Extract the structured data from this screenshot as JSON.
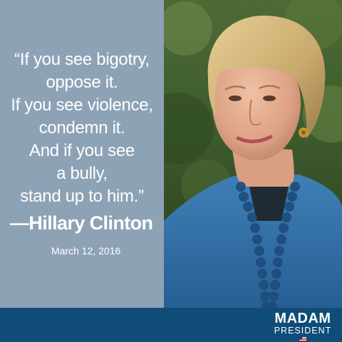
{
  "quote": {
    "lines": [
      "“If you see bigotry,",
      "oppose it.",
      "If you see violence,",
      "condemn it.",
      "And if you see",
      "a bully,",
      "stand up to him.”"
    ],
    "attribution": "—Hillary Clinton",
    "date": "March 12, 2016"
  },
  "brand": {
    "line1": "MADAM",
    "line2": "PRESIDENT"
  },
  "colors": {
    "panel": "#8ea2b6",
    "bar": "#0f4d78",
    "text": "#ffffff"
  },
  "photo": {
    "subject": "portrait-photo",
    "icons": [
      "flag-icon"
    ]
  }
}
